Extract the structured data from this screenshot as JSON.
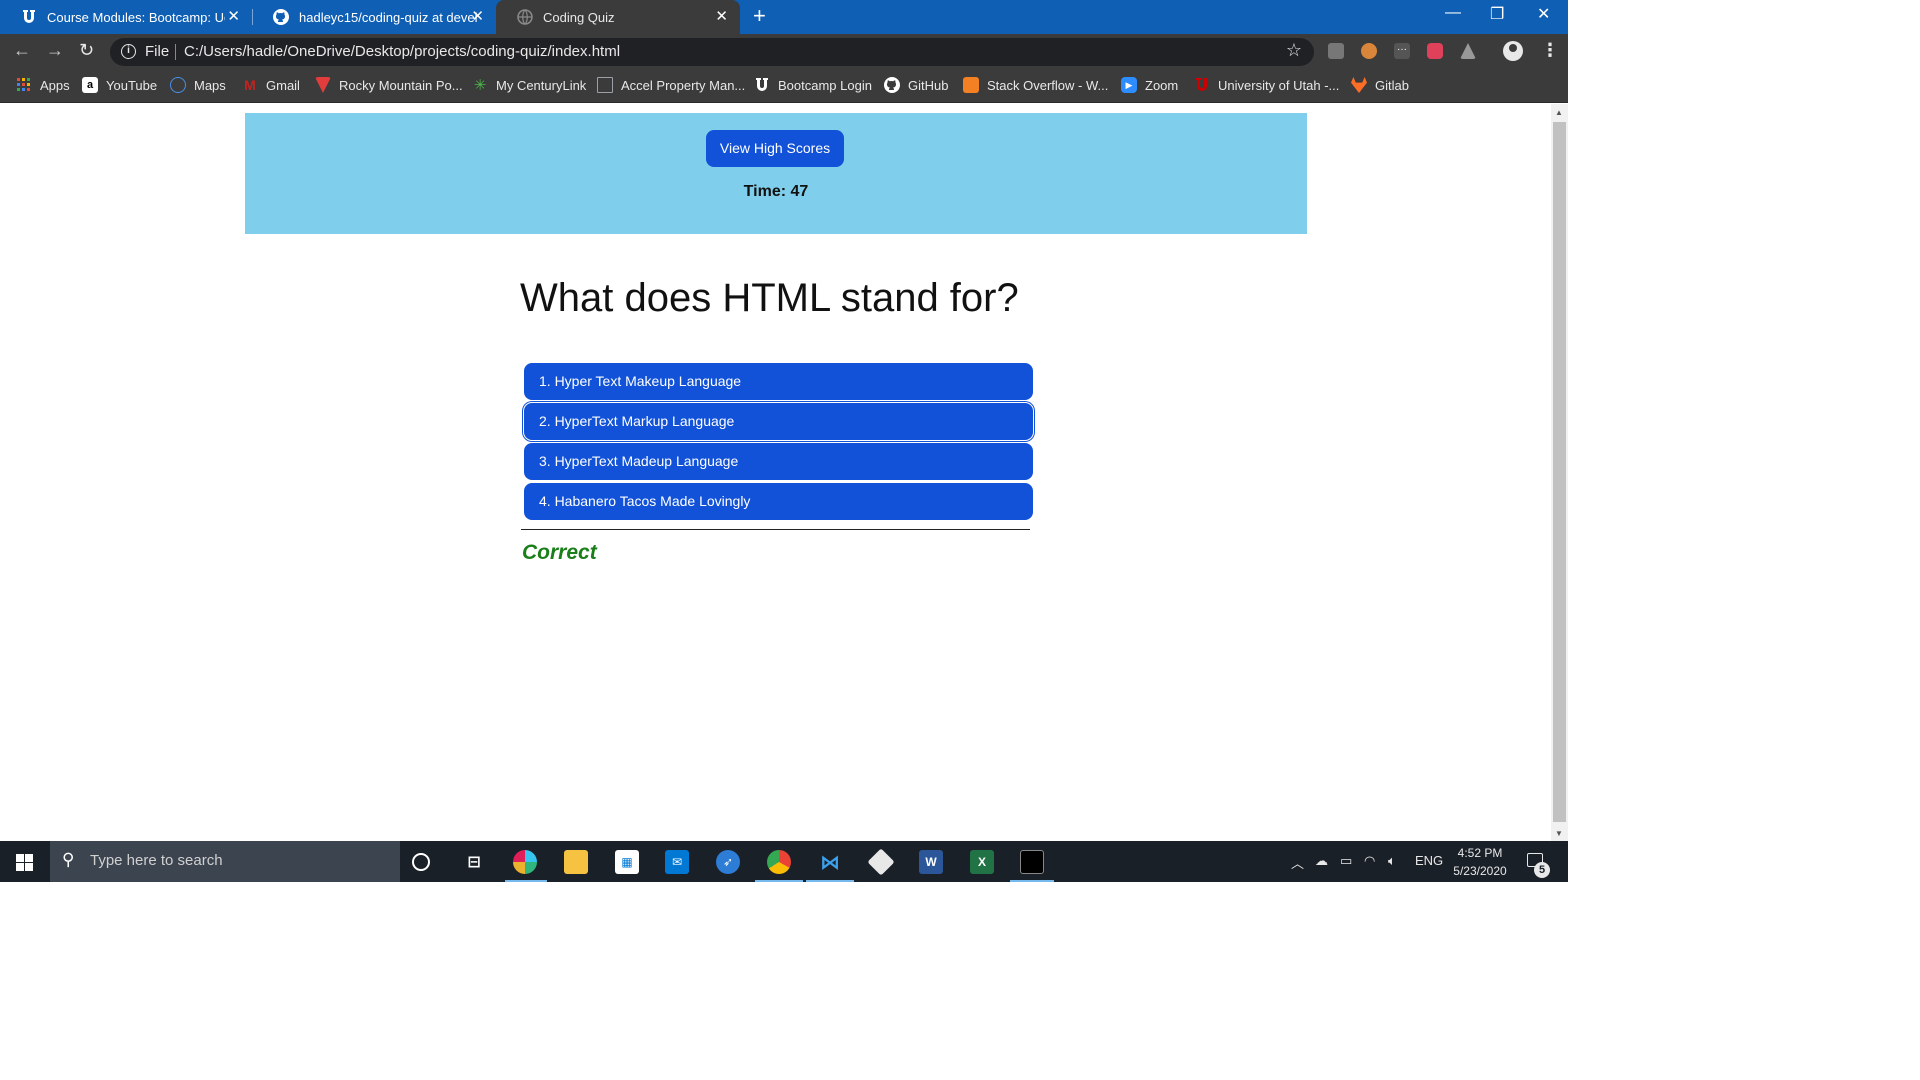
{
  "browser": {
    "tabs": [
      {
        "title": "Course Modules: Bootcamp: UofU",
        "icon": "utah-u-icon"
      },
      {
        "title": "hadleyc15/coding-quiz at develop",
        "icon": "github-icon"
      },
      {
        "title": "Coding Quiz",
        "icon": "globe-icon"
      }
    ],
    "address": {
      "scheme_label": "File",
      "url": "C:/Users/hadle/OneDrive/Desktop/projects/coding-quiz/index.html"
    },
    "bookmarks": [
      {
        "label": "Apps",
        "icon": "apps-grid-icon",
        "color": "#e04d3b"
      },
      {
        "label": "YouTube",
        "icon": "amazon-icon",
        "color": "#ffffff"
      },
      {
        "label": "Maps",
        "icon": "maps-icon",
        "color": "#4a8fe7"
      },
      {
        "label": "Gmail",
        "icon": "gmail-icon",
        "color": "#c5221f"
      },
      {
        "label": "Rocky Mountain Po...",
        "icon": "rocky-mountain-icon",
        "color": "#e23c3c"
      },
      {
        "label": "My CenturyLink",
        "icon": "centurylink-icon",
        "color": "#4cb849"
      },
      {
        "label": "Accel Property Man...",
        "icon": "building-icon",
        "color": "#9aa0a6"
      },
      {
        "label": "Bootcamp Login",
        "icon": "utah-u-icon",
        "color": "#ffffff"
      },
      {
        "label": "GitHub",
        "icon": "github-icon",
        "color": "#ffffff"
      },
      {
        "label": "Stack Overflow - W...",
        "icon": "stackoverflow-icon",
        "color": "#f48024"
      },
      {
        "label": "Zoom",
        "icon": "zoom-icon",
        "color": "#2d8cff"
      },
      {
        "label": "University of Utah -...",
        "icon": "utah-u-icon",
        "color": "#cc0000"
      },
      {
        "label": "Gitlab",
        "icon": "gitlab-icon",
        "color": "#fc6d26"
      }
    ]
  },
  "quiz": {
    "high_scores_label": "View High Scores",
    "timer_label": "Time:",
    "timer_value": "47",
    "question": "What does HTML stand for?",
    "answers": [
      "1. Hyper Text Makeup Language",
      "2. HyperText Markup Language",
      "3. HyperText Madeup Language",
      "4. Habanero Tacos Made Lovingly"
    ],
    "feedback": "Correct",
    "colors": {
      "header_bg": "#7fcfec",
      "button_bg": "#1152d8",
      "feedback": "#1a7f1a"
    }
  },
  "taskbar": {
    "search_placeholder": "Type here to search",
    "language": "ENG",
    "time": "4:52 PM",
    "date": "5/23/2020",
    "notification_count": "5"
  }
}
